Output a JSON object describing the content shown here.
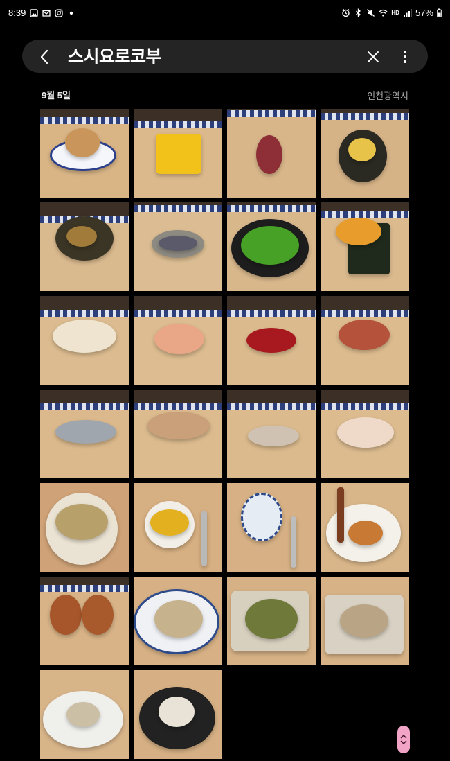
{
  "status_bar": {
    "time": "8:39",
    "left_icons": [
      "image-icon",
      "mail-icon",
      "instagram-icon",
      "notification-dot-icon"
    ],
    "right_icons": [
      "alarm-icon",
      "bluetooth-icon",
      "mute-icon",
      "wifi-icon",
      "hd-voice-icon",
      "signal-icon"
    ],
    "hd_label": "HD",
    "battery_text": "57%"
  },
  "search": {
    "query": "스시요로코부",
    "back_icon": "chevron-left-icon",
    "clear_icon": "close-icon",
    "more_icon": "more-vertical-icon"
  },
  "section": {
    "date": "9월 5일",
    "location": "인천광역시"
  },
  "colors": {
    "background": "#000000",
    "pill": "#242424",
    "scroll_handle": "#f2a4c6"
  },
  "photos": [
    {
      "subject": "sweet-bun-on-blue-plate"
    },
    {
      "subject": "tamago-egg-block"
    },
    {
      "subject": "tuna-nigiri"
    },
    {
      "subject": "maki-roll"
    },
    {
      "subject": "futomaki-roll"
    },
    {
      "subject": "mackerel-nigiri"
    },
    {
      "subject": "green-soup-bowl"
    },
    {
      "subject": "uni-gunkan"
    },
    {
      "subject": "white-fish-nigiri"
    },
    {
      "subject": "shrimp-nigiri"
    },
    {
      "subject": "akami-tuna-nigiri"
    },
    {
      "subject": "fatty-tuna-nigiri"
    },
    {
      "subject": "kohada-nigiri"
    },
    {
      "subject": "aji-nigiri"
    },
    {
      "subject": "sanma-nigiri"
    },
    {
      "subject": "white-fish-nigiri-2"
    },
    {
      "subject": "chawanmushi-closeup"
    },
    {
      "subject": "chawanmushi-with-spoon"
    },
    {
      "subject": "lidded-cup-with-spoon"
    },
    {
      "subject": "dessert-on-white-plate"
    },
    {
      "subject": "fried-rolls"
    },
    {
      "subject": "plated-eel-dish"
    },
    {
      "subject": "abalone-dish"
    },
    {
      "subject": "abalone-dish-2"
    },
    {
      "subject": "white-fish-salad"
    },
    {
      "subject": "rice-dish-dark-plate"
    }
  ],
  "scroll_handle": {
    "icon_up": "chevron-up-icon",
    "icon_down": "chevron-down-icon"
  }
}
